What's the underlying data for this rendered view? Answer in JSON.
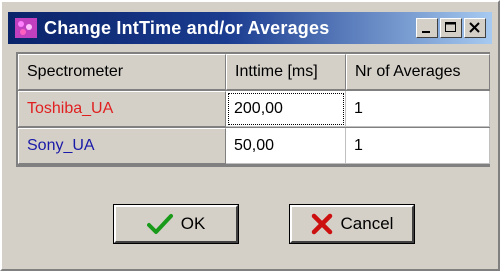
{
  "window": {
    "title": "Change IntTime and/or  Averages"
  },
  "grid": {
    "columns": [
      "Spectrometer",
      "Inttime [ms]",
      "Nr of Averages"
    ],
    "rows": [
      {
        "spectrometer": "Toshiba_UA",
        "inttime": "200,00",
        "averages": "1",
        "name_color": "#e02020"
      },
      {
        "spectrometer": "Sony_UA",
        "inttime": "50,00",
        "averages": "1",
        "name_color": "#1a1aa8"
      }
    ]
  },
  "buttons": {
    "ok_label": "OK",
    "cancel_label": "Cancel"
  },
  "colors": {
    "titlebar_start": "#0a246a",
    "titlebar_end": "#a6caf0",
    "ok_check": "#1a9a1a",
    "cancel_x": "#cc1010"
  }
}
